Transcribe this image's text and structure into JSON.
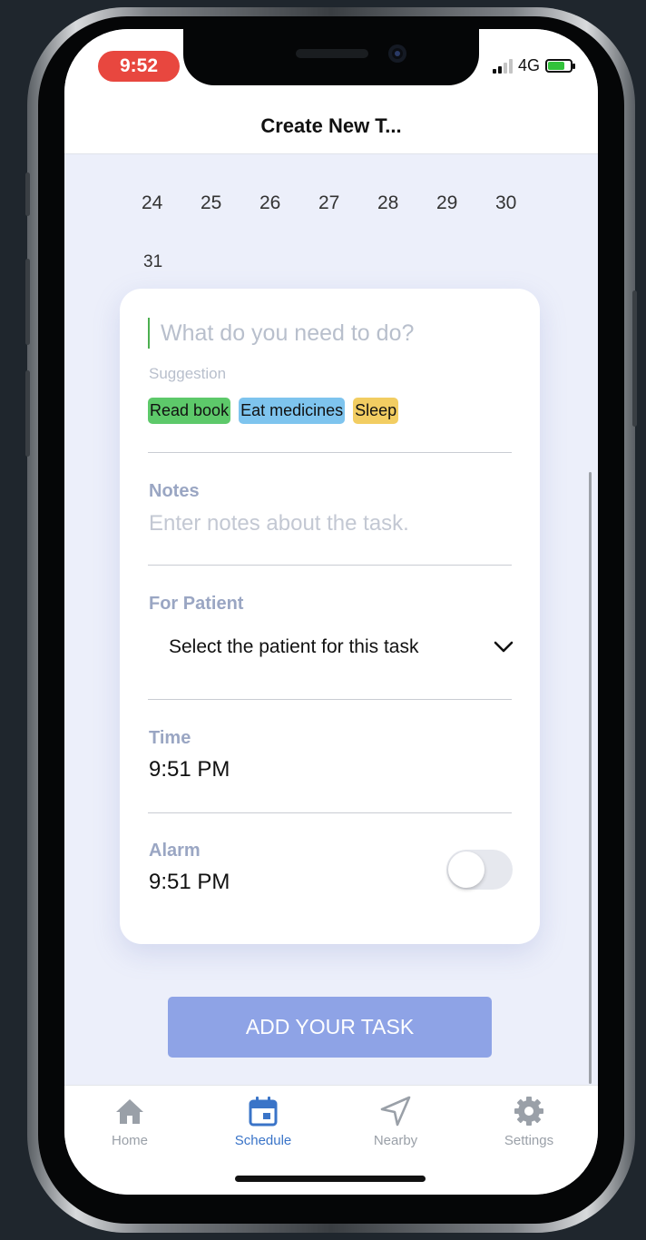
{
  "status_bar": {
    "time": "9:52",
    "network": "4G"
  },
  "header": {
    "title": "Create New T..."
  },
  "calendar": {
    "dates": [
      "24",
      "25",
      "26",
      "27",
      "28",
      "29",
      "30"
    ],
    "last_date": "31"
  },
  "task": {
    "placeholder": "What do you need to do?",
    "suggestion_label": "Suggestion",
    "suggestions": [
      {
        "label": "Read book",
        "color": "#5dc96a"
      },
      {
        "label": "Eat medicines",
        "color": "#7ec4ee"
      },
      {
        "label": "Sleep",
        "color": "#f2cd62"
      }
    ]
  },
  "notes": {
    "label": "Notes",
    "placeholder": "Enter notes about the task."
  },
  "patient": {
    "label": "For Patient",
    "selected": "Select the patient for this task"
  },
  "time": {
    "label": "Time",
    "value": "9:51 PM"
  },
  "alarm": {
    "label": "Alarm",
    "value": "9:51 PM",
    "enabled": false
  },
  "add_button": {
    "label": "ADD YOUR TASK"
  },
  "tabs": [
    {
      "label": "Home",
      "icon": "home-icon",
      "active": false
    },
    {
      "label": "Schedule",
      "icon": "calendar-icon",
      "active": true
    },
    {
      "label": "Nearby",
      "icon": "navigation-icon",
      "active": false
    },
    {
      "label": "Settings",
      "icon": "gear-icon",
      "active": false
    }
  ],
  "colors": {
    "accent": "#3a74c8",
    "button": "#8ea3e6",
    "status_time": "#e8473f"
  }
}
